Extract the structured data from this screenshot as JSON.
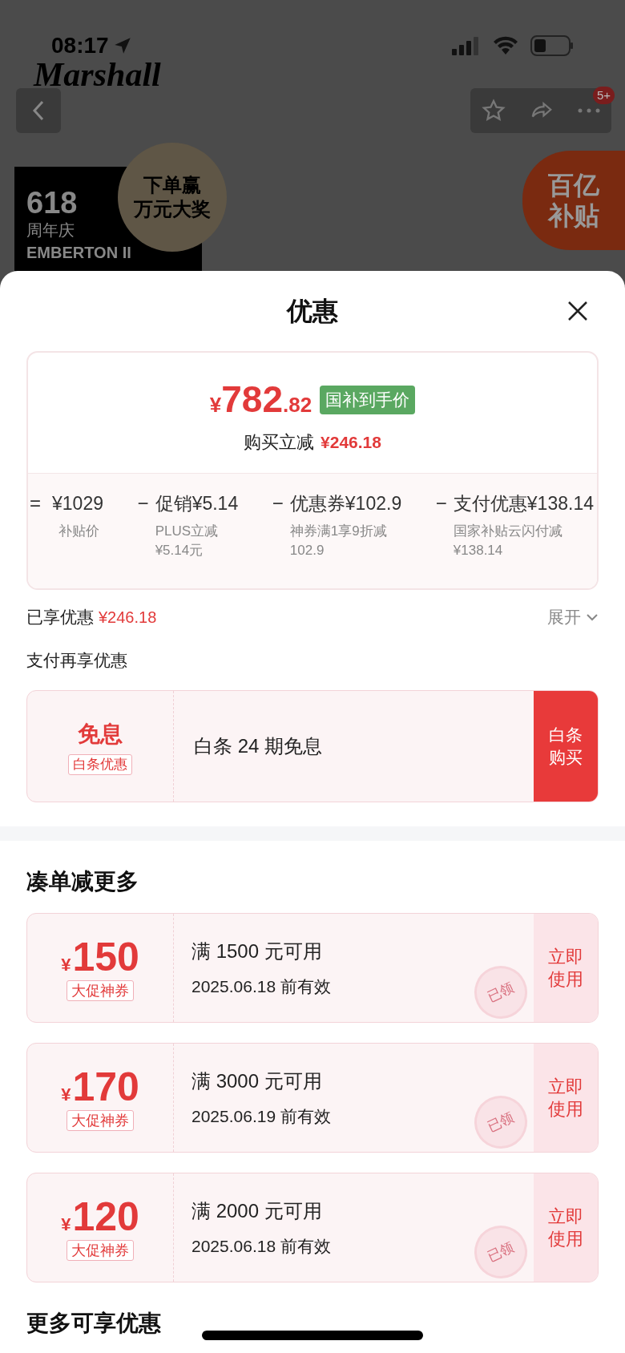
{
  "status_bar": {
    "time": "08:17"
  },
  "background": {
    "brand": "Marshall",
    "badge": "5+",
    "promo_box": [
      "618",
      "周年庆",
      "EMBERTON II"
    ],
    "prize_badge": [
      "下单赢",
      "万元大奖"
    ],
    "subsidy_badge": [
      "百亿",
      "补贴"
    ]
  },
  "sheet": {
    "title": "优惠"
  },
  "price_card": {
    "currency": "¥",
    "integer": "782",
    "decimal": ".82",
    "tag": "国补到手价",
    "reduction_label": "购买立减",
    "reduction": "¥246.18",
    "breakdown": [
      {
        "operator": "=",
        "label": "¥1029",
        "notes": [
          "补贴价"
        ]
      },
      {
        "operator": "−",
        "label": "促销¥5.14",
        "notes": [
          "PLUS立减",
          "¥5.14元"
        ]
      },
      {
        "operator": "−",
        "label": "优惠券¥102.9",
        "notes": [
          "神券满1享9折减",
          "102.9"
        ]
      },
      {
        "operator": "−",
        "label": "支付优惠¥138.14",
        "notes": [
          "国家补贴云闪付减",
          "¥138.14"
        ]
      }
    ]
  },
  "enjoyed": {
    "label": "已享优惠",
    "amount": "¥246.18",
    "expand": "展开"
  },
  "pay_section": {
    "title": "支付再享优惠",
    "offer": {
      "badge_title": "免息",
      "badge_tag": "白条优惠",
      "text": "白条 24 期免息",
      "button": "白条购买"
    }
  },
  "coupon_section": {
    "title": "凑单减更多",
    "coupons": [
      {
        "currency": "¥",
        "amount": "150",
        "tag": "大促神券",
        "condition": "满 1500 元可用",
        "expiry": "2025.06.18 前有效",
        "action": "立即使用",
        "stamp": "已领"
      },
      {
        "currency": "¥",
        "amount": "170",
        "tag": "大促神券",
        "condition": "满 3000 元可用",
        "expiry": "2025.06.19 前有效",
        "action": "立即使用",
        "stamp": "已领"
      },
      {
        "currency": "¥",
        "amount": "120",
        "tag": "大促神券",
        "condition": "满 2000 元可用",
        "expiry": "2025.06.18 前有效",
        "action": "立即使用",
        "stamp": "已领"
      }
    ]
  },
  "more_section": {
    "title": "更多可享优惠"
  }
}
